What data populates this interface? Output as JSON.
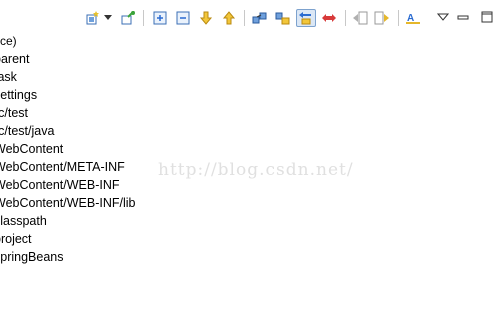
{
  "panel": {
    "header_text": "ce)",
    "items": [
      {
        "label": "parent"
      },
      {
        "label": "task"
      },
      {
        "label": "settings"
      },
      {
        "label": "rc/test"
      },
      {
        "label": "rc/test/java"
      },
      {
        "label": "WebContent"
      },
      {
        "label": "WebContent/META-INF"
      },
      {
        "label": "WebContent/WEB-INF"
      },
      {
        "label": "WebContent/WEB-INF/lib"
      },
      {
        "label": "classpath"
      },
      {
        "label": "project"
      },
      {
        "label": "springBeans"
      }
    ]
  },
  "toolbar": {
    "icons": [
      "new-type-icon",
      "dropdown-arrow-icon",
      "pin-icon",
      "expand-all-icon",
      "collapse-all-icon",
      "move-down-icon",
      "move-up-icon",
      "link-icon",
      "filter-icon",
      "sync-icon",
      "remove-icon",
      "back-icon",
      "forward-icon",
      "text-icon",
      "view-menu-icon",
      "minimize-icon",
      "maximize-icon"
    ],
    "active_icon": "sync-icon"
  },
  "watermark": {
    "text": "http://blog.csdn.net/"
  },
  "colors": {
    "accent_blue": "#2a6bd1",
    "arrow_yellow": "#e5b72a",
    "remove_red": "#d83a3a",
    "pin_green": "#3aa33a"
  }
}
